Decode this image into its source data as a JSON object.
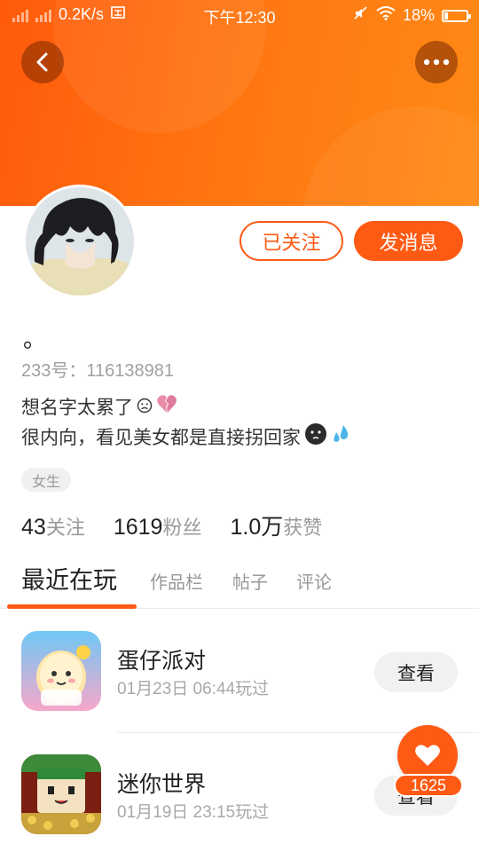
{
  "status_bar": {
    "speed": "0.2K/s",
    "time": "下午12:30",
    "battery": "18%",
    "battery_level": 0.18
  },
  "profile": {
    "nickname": "。",
    "uid_label": "233号：116138981",
    "bio_line1": "想名字太累了",
    "bio_line2": "很内向，看见美女都是直接拐回家",
    "gender_tag": "女生",
    "follow_button": "已关注",
    "message_button": "发消息"
  },
  "stats": [
    {
      "num": "43",
      "label": "关注"
    },
    {
      "num": "1619",
      "label": "粉丝"
    },
    {
      "num": "1.0万",
      "label": "获赞"
    }
  ],
  "tabs": [
    {
      "label": "最近在玩",
      "active": true
    },
    {
      "label": "作品栏",
      "active": false
    },
    {
      "label": "帖子",
      "active": false
    },
    {
      "label": "评论",
      "active": false
    }
  ],
  "games": [
    {
      "title": "蛋仔派对",
      "time": "01月23日 06:44玩过",
      "button": "查看",
      "icon": "eggy-party-icon"
    },
    {
      "title": "迷你世界",
      "time": "01月19日 23:15玩过",
      "button": "查看",
      "icon": "mini-world-icon"
    }
  ],
  "like_fab": {
    "count": "1625",
    "icon": "heart-icon"
  },
  "colors": {
    "accent": "#ff5a14",
    "header_orange": "#ff7410"
  }
}
